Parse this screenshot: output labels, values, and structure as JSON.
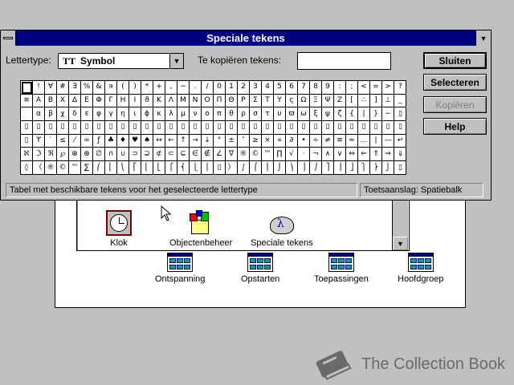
{
  "dialog": {
    "title": "Speciale tekens",
    "font_label": "Lettertype:",
    "font_value": "Symbol",
    "font_type_icon": "TT",
    "copy_label": "Te kopiëren tekens:",
    "copy_value": "",
    "buttons": {
      "close": "Sluiten",
      "select": "Selecteren",
      "copy": "Kopiëren",
      "help": "Help"
    },
    "status_left": "Tabel met beschikbare tekens voor het geselecteerde lettertype",
    "status_right": "Toetsaanslag: Spatiebalk",
    "grid_rows": [
      [
        " ",
        "!",
        "∀",
        "#",
        "∃",
        "%",
        "&",
        "∍",
        "(",
        ")",
        "*",
        "+",
        ",",
        "−",
        ".",
        "/",
        "0",
        "1",
        "2",
        "3",
        "4",
        "5",
        "6",
        "7",
        "8",
        "9",
        ":",
        ";",
        "<",
        "=",
        ">",
        "?"
      ],
      [
        "≅",
        "Α",
        "Β",
        "Χ",
        "Δ",
        "Ε",
        "Φ",
        "Γ",
        "Η",
        "Ι",
        "ϑ",
        "Κ",
        "Λ",
        "Μ",
        "Ν",
        "Ο",
        "Π",
        "Θ",
        "Ρ",
        "Σ",
        "Τ",
        "Υ",
        "ς",
        "Ω",
        "Ξ",
        "Ψ",
        "Ζ",
        "[",
        "∴",
        "]",
        "⊥",
        "_"
      ],
      [
        "",
        "α",
        "β",
        "χ",
        "δ",
        "ε",
        "φ",
        "γ",
        "η",
        "ι",
        "ϕ",
        "κ",
        "λ",
        "μ",
        "ν",
        "ο",
        "π",
        "θ",
        "ρ",
        "σ",
        "τ",
        "υ",
        "ϖ",
        "ω",
        "ξ",
        "ψ",
        "ζ",
        "{",
        "|",
        "}",
        "∼",
        "▯"
      ],
      [
        "▯",
        "▯",
        "▯",
        "▯",
        "▯",
        "▯",
        "▯",
        "▯",
        "▯",
        "▯",
        "▯",
        "▯",
        "▯",
        "▯",
        "▯",
        "▯",
        "▯",
        "▯",
        "▯",
        "▯",
        "▯",
        "▯",
        "▯",
        "▯",
        "▯",
        "▯",
        "▯",
        "▯",
        "▯",
        "▯",
        "▯",
        "▯"
      ],
      [
        "▯",
        "ϒ",
        "′",
        "≤",
        "⁄",
        "∞",
        "ƒ",
        "♣",
        "♦",
        "♥",
        "♠",
        "↔",
        "←",
        "↑",
        "→",
        "↓",
        "°",
        "±",
        "″",
        "≥",
        "×",
        "∝",
        "∂",
        "•",
        "÷",
        "≠",
        "≡",
        "≈",
        "…",
        "|",
        "—",
        "↵"
      ],
      [
        "ℵ",
        "ℑ",
        "ℜ",
        "℘",
        "⊗",
        "⊕",
        "∅",
        "∩",
        "∪",
        "⊃",
        "⊇",
        "⊄",
        "⊂",
        "⊆",
        "∈",
        "∉",
        "∠",
        "∇",
        "®",
        "©",
        "™",
        "∏",
        "√",
        "⋅",
        "¬",
        "∧",
        "∨",
        "⇔",
        "⇐",
        "⇑",
        "⇒",
        "⇓"
      ],
      [
        "◊",
        "〈",
        "®",
        "©",
        "™",
        "∑",
        "⎛",
        "⎜",
        "⎝",
        "⎡",
        "⎢",
        "⎣",
        "⎧",
        "⎨",
        "⎩",
        "⎪",
        "▯",
        "〉",
        "∫",
        "⌠",
        "⎮",
        "⌡",
        "⎞",
        "⎟",
        "⎠",
        "⎤",
        "⎥",
        "⎦",
        "⎫",
        "⎬",
        "⎭",
        "▯"
      ]
    ]
  },
  "group_window": {
    "icons": [
      {
        "label": "Klok",
        "icon": "clock-icon"
      },
      {
        "label": "Objectenbeheer",
        "icon": "object-packager-icon"
      },
      {
        "label": "Speciale tekens",
        "icon": "character-map-icon"
      }
    ]
  },
  "program_groups": [
    {
      "label": "Ontspanning"
    },
    {
      "label": "Opstarten"
    },
    {
      "label": "Toepassingen"
    },
    {
      "label": "Hoofdgroep"
    }
  ],
  "watermark": {
    "text": "The Collection Book"
  },
  "colors": {
    "titlebar": "#000080",
    "face": "#c0c0c0"
  }
}
